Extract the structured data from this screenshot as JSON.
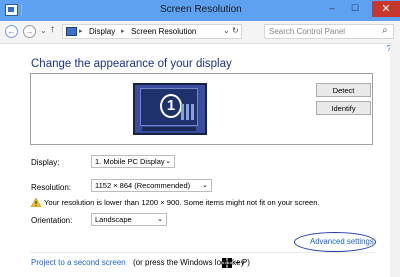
{
  "window": {
    "title": "Screen Resolution",
    "close_glyph": "✕",
    "minimize_glyph": "–",
    "maximize_glyph": "☐"
  },
  "nav": {
    "back_glyph": "←",
    "forward_glyph": "→",
    "recent_glyph": "⌄",
    "up_glyph": "↑",
    "separator": "▸"
  },
  "breadcrumb": [
    "Display",
    "Screen Resolution"
  ],
  "address_dropdown_glyph": "⌄",
  "refresh_glyph": "↻",
  "search": {
    "placeholder": "Search Control Panel",
    "icon_glyph": "⌕"
  },
  "help_glyph": "?",
  "page": {
    "heading": "Change the appearance of your display",
    "monitor_number": "1",
    "detect_label": "Detect",
    "identify_label": "Identify",
    "display_label": "Display:",
    "display_value": "1. Mobile PC Display",
    "resolution_label": "Resolution:",
    "resolution_value": "1152 × 864 (Recommended)",
    "warning_text": "Your resolution is lower than 1200 × 900. Some items might not fit on your screen.",
    "orientation_label": "Orientation:",
    "orientation_value": "Landscape",
    "advanced_link": "Advanced settings",
    "project_link": "Project to a second screen",
    "project_hint": "(or press the Windows logo key",
    "project_hint_tail": "+ P)"
  },
  "colors": {
    "titlebar": "#5ea1f0",
    "heading": "#1e3287",
    "link": "#1e64c8",
    "annotation_circle": "#1e3ab0"
  }
}
